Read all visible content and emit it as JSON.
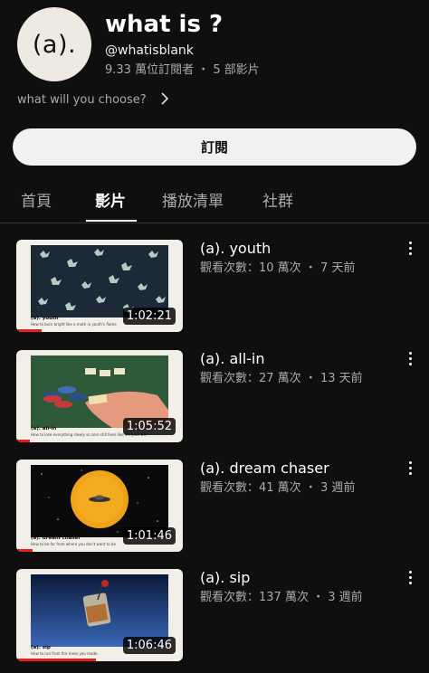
{
  "channel": {
    "avatar_text": "(a).",
    "title": "what is ?",
    "handle": "@whatisblank",
    "stats": "9.33 萬位訂閱者 ・ 5 部影片",
    "bio": "what will you choose?",
    "bio_icon": "chevron-right-icon"
  },
  "subscribe_label": "訂閱",
  "tabs": [
    {
      "label": "首頁"
    },
    {
      "label": "影片"
    },
    {
      "label": "播放清單"
    },
    {
      "label": "社群"
    }
  ],
  "active_tab": 1,
  "videos": [
    {
      "title": "(a). youth",
      "meta": "觀看次數：10 萬次 ・ 7 天前",
      "duration": "1:02:21",
      "caption_title": "(a). youth",
      "caption_sub": "How to burn bright like a moth in youth's flame",
      "progress": 0.15
    },
    {
      "title": "(a). all-in",
      "meta": "觀看次數：27 萬次 ・ 13 天前",
      "duration": "1:05:52",
      "caption_title": "(a). all-in",
      "caption_sub": "How to lose everything slowly so zero still feels like it's your win",
      "progress": 0.08
    },
    {
      "title": "(a). dream chaser",
      "meta": "觀看次數：41 萬次 ・ 3 週前",
      "duration": "1:01:46",
      "caption_title": "(a). dream chaser",
      "caption_sub": "How to be far from where you don't want to be",
      "progress": 0.1
    },
    {
      "title": "(a). sip",
      "meta": "觀看次數：137 萬次 ・ 3 週前",
      "duration": "1:06:46",
      "caption_title": "(a). sip",
      "caption_sub": "How to run from the mess you made",
      "progress": 0.48
    }
  ],
  "icons": {
    "more": "more-vert-icon"
  },
  "colors": {
    "background": "#0f0f0f",
    "accent": "#e5201c",
    "subscribe_bg": "#f1f1f1"
  }
}
